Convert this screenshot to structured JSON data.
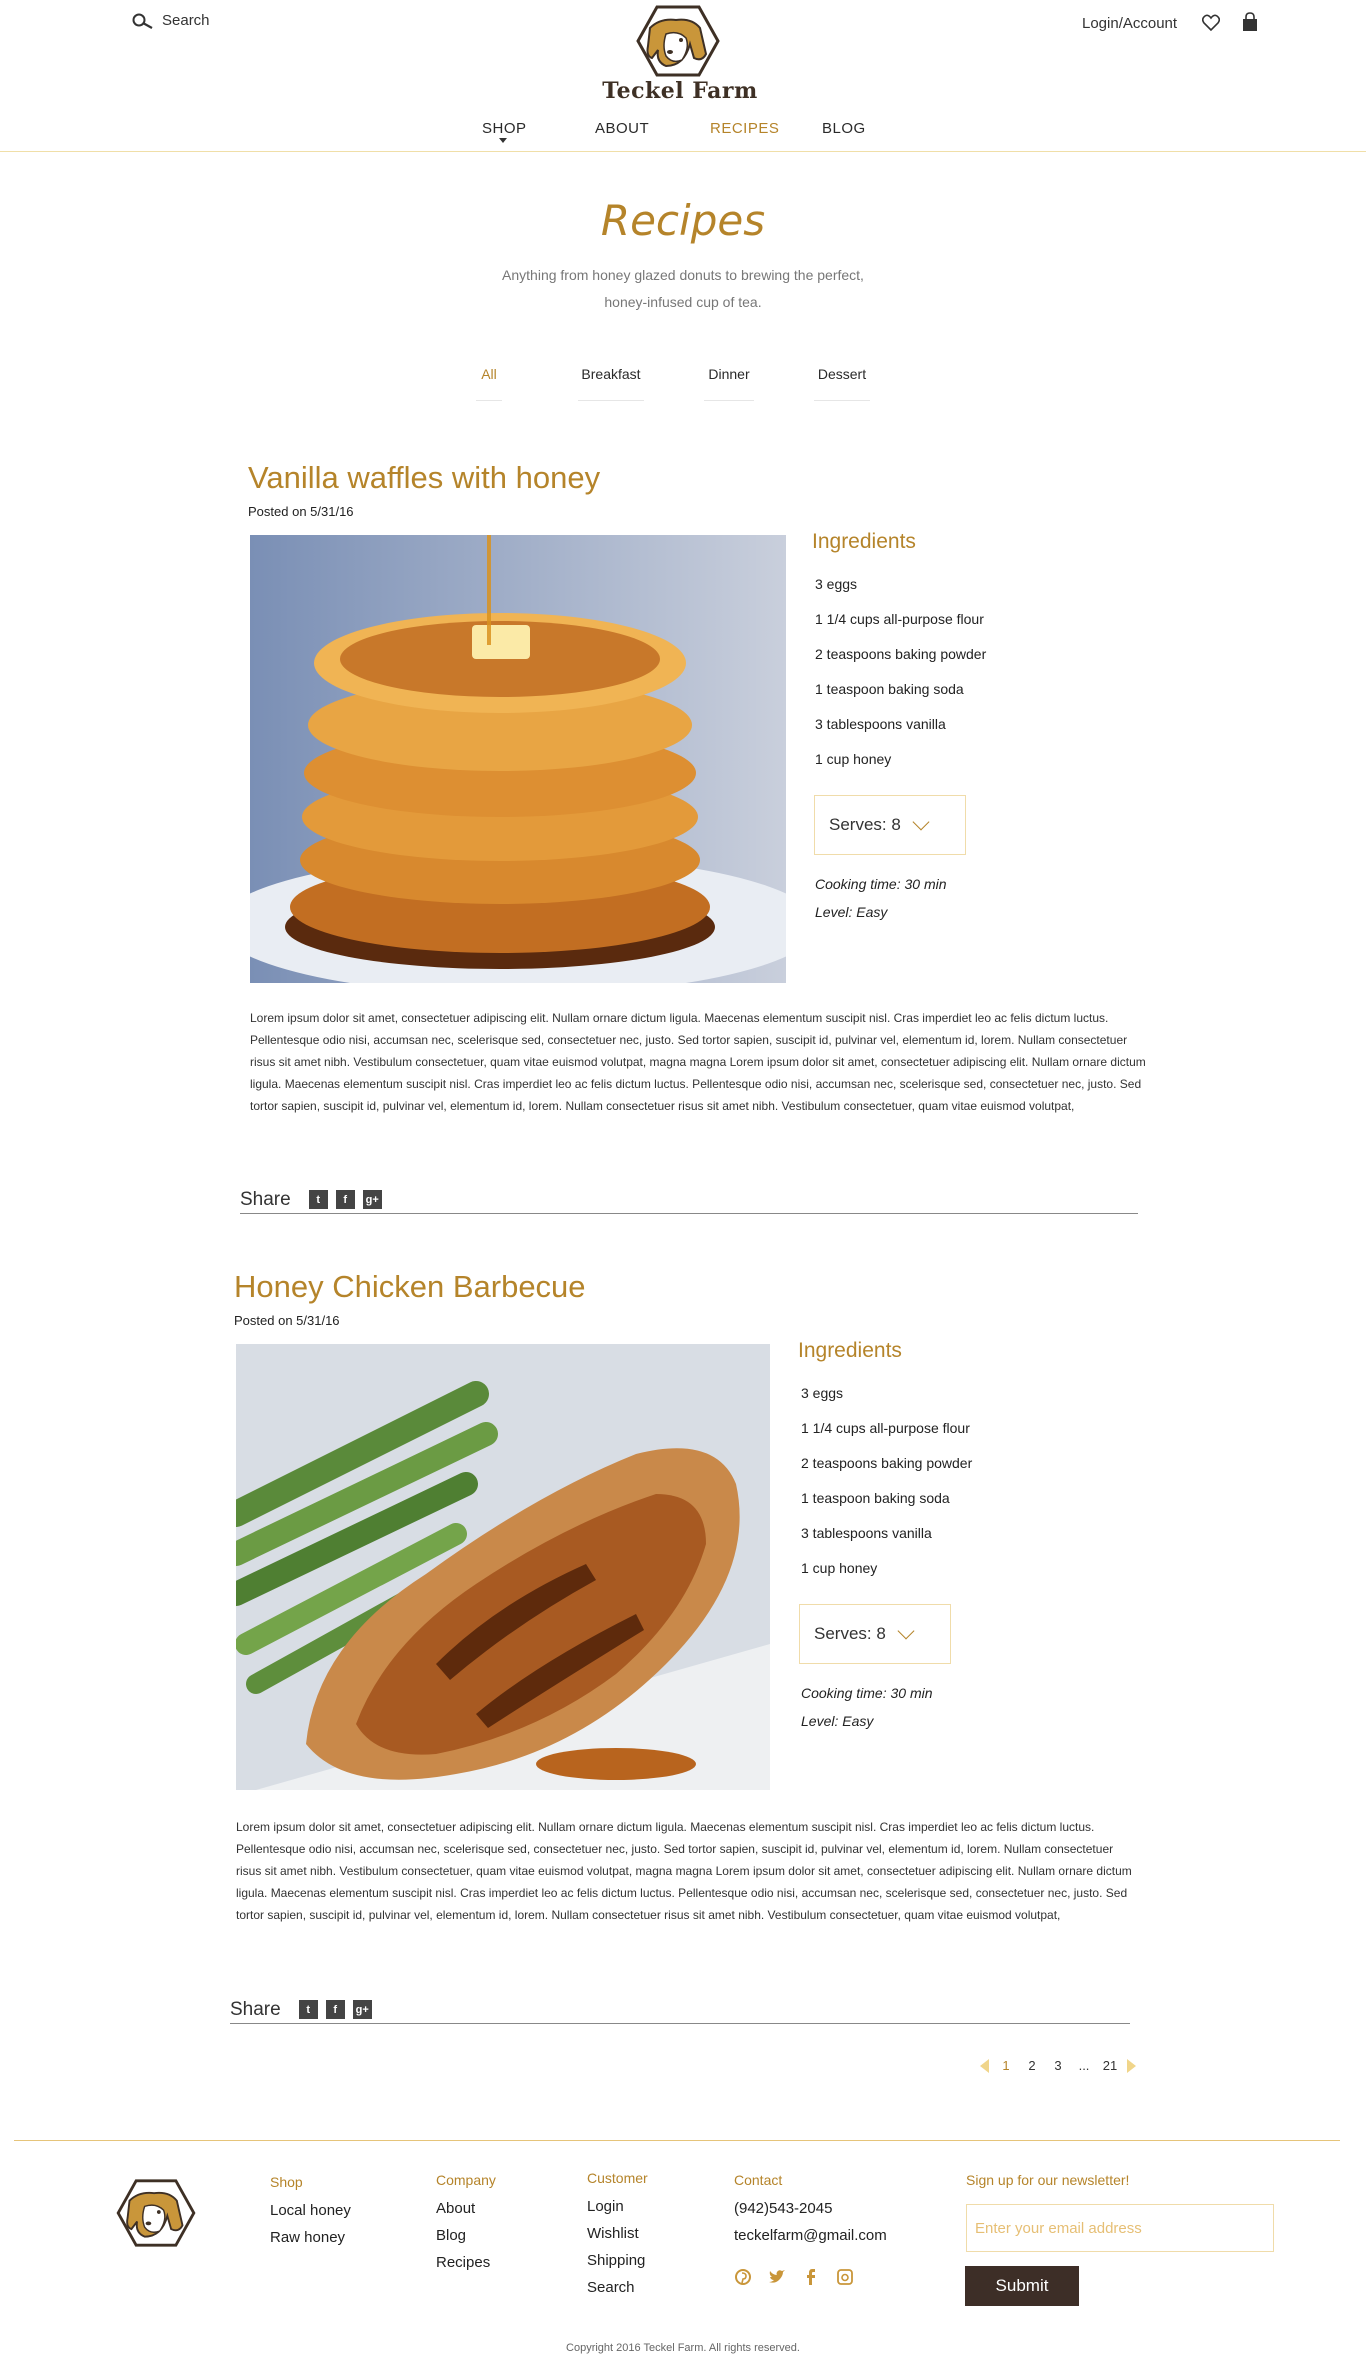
{
  "header": {
    "search_label": "Search",
    "brand": "Teckel Farm",
    "account": "Login/Account",
    "nav": [
      "SHOP",
      "ABOUT",
      "RECIPES",
      "BLOG"
    ]
  },
  "page": {
    "title": "Recipes",
    "subtitle": "Anything from honey glazed donuts to brewing the perfect, honey-infused cup of tea."
  },
  "filters": [
    "All",
    "Breakfast",
    "Dinner",
    "Dessert"
  ],
  "recipes": [
    {
      "title": "Vanilla waffles with honey",
      "posted": "Posted on 5/31/16",
      "ingredients_heading": "Ingredients",
      "ingredients": [
        "3 eggs",
        "1 1/4 cups all-purpose flour",
        "2 teaspoons baking powder",
        "1 teaspoon baking soda",
        "3 tablespoons vanilla",
        "1 cup honey"
      ],
      "serves": "Serves: 8",
      "cooking_time": "Cooking time: 30 min",
      "level": "Level: Easy",
      "body": "Lorem ipsum dolor sit amet, consectetuer adipiscing elit. Nullam ornare dictum ligula. Maecenas elementum suscipit nisl. Cras imperdiet leo ac felis dictum luctus. Pellentesque odio nisi, accumsan nec, scelerisque sed, consectetuer nec, justo. Sed tortor sapien, suscipit id, pulvinar vel, elementum id, lorem. Nullam consectetuer risus sit amet nibh. Vestibulum consectetuer, quam vitae euismod volutpat, magna magna Lorem ipsum dolor sit amet, consectetuer adipiscing elit. Nullam ornare dictum ligula. Maecenas elementum suscipit nisl. Cras imperdiet leo ac felis dictum luctus. Pellentesque odio nisi, accumsan nec, scelerisque sed, consectetuer nec, justo. Sed tortor sapien, suscipit id, pulvinar vel, elementum id, lorem. Nullam consectetuer risus sit amet nibh. Vestibulum consectetuer, quam vitae euismod volutpat,",
      "share": "Share"
    },
    {
      "title": "Honey Chicken Barbecue",
      "posted": "Posted on 5/31/16",
      "ingredients_heading": "Ingredients",
      "ingredients": [
        "3 eggs",
        "1 1/4 cups all-purpose flour",
        "2 teaspoons baking powder",
        "1 teaspoon baking soda",
        "3 tablespoons vanilla",
        "1 cup honey"
      ],
      "serves": "Serves: 8",
      "cooking_time": "Cooking time: 30 min",
      "level": "Level: Easy",
      "body": "Lorem ipsum dolor sit amet, consectetuer adipiscing elit. Nullam ornare dictum ligula. Maecenas elementum suscipit nisl. Cras imperdiet leo ac felis dictum luctus. Pellentesque odio nisi, accumsan nec, scelerisque sed, consectetuer nec, justo. Sed tortor sapien, suscipit id, pulvinar vel, elementum id, lorem. Nullam consectetuer risus sit amet nibh. Vestibulum consectetuer, quam vitae euismod volutpat, magna magna Lorem ipsum dolor sit amet, consectetuer adipiscing elit. Nullam ornare dictum ligula. Maecenas elementum suscipit nisl. Cras imperdiet leo ac felis dictum luctus. Pellentesque odio nisi, accumsan nec, scelerisque sed, consectetuer nec, justo. Sed tortor sapien, suscipit id, pulvinar vel, elementum id, lorem. Nullam consectetuer risus sit amet nibh. Vestibulum consectetuer, quam vitae euismod volutpat,",
      "share": "Share"
    }
  ],
  "share_buttons": [
    "t",
    "f",
    "g+"
  ],
  "pagination": [
    "1",
    "2",
    "3",
    "...",
    "21"
  ],
  "footer": {
    "shop": {
      "heading": "Shop",
      "items": [
        "Local honey",
        "Raw honey"
      ]
    },
    "company": {
      "heading": "Company",
      "items": [
        "About",
        "Blog",
        "Recipes"
      ]
    },
    "customer": {
      "heading": "Customer",
      "items": [
        "Login",
        "Wishlist",
        "Shipping",
        "Search"
      ]
    },
    "contact": {
      "heading": "Contact",
      "phone": "(942)543-2045",
      "email": "teckelfarm@gmail.com"
    },
    "newsletter": {
      "heading": "Sign up for our newsletter!",
      "placeholder": "Enter your email address",
      "submit": "Submit"
    },
    "copyright": "Copyright 2016 Teckel Farm. All rights reserved."
  },
  "icons": {
    "search": "search-icon",
    "heart": "heart-icon",
    "bag": "shopping-bag-icon",
    "social": [
      "pinterest-icon",
      "twitter-icon",
      "facebook-icon",
      "instagram-icon"
    ]
  },
  "colors": {
    "accent": "#b5842a",
    "dark": "#3d2e27",
    "border": "#f0dcaa"
  }
}
